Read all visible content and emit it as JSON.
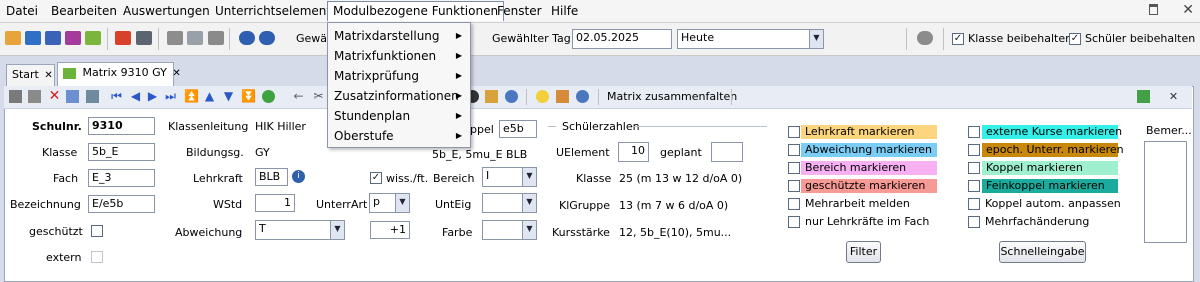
{
  "menubar": {
    "items": [
      "Datei",
      "Bearbeiten",
      "Auswertungen",
      "Unterrichtselement",
      "Modulbezogene Funktionen",
      "Fenster",
      "Hilfe"
    ]
  },
  "toolbar": {
    "gewaehlt_truncated": "Gewä",
    "gewaehlter_tag_label": "Gewählter Tag",
    "date_value": "02.05.2025",
    "heute_value": "Heute",
    "klasse_beibehalten": "Klasse beibehalten",
    "schueler_beibehalten": "Schüler beibehalten"
  },
  "tabs": [
    {
      "label": "Start"
    },
    {
      "label": "Matrix 9310 GY"
    }
  ],
  "dropdown": {
    "items": [
      "Matrixdarstellung",
      "Matrixfunktionen",
      "Matrixprüfung",
      "Zusatzinformationen",
      "Stundenplan",
      "Oberstufe"
    ]
  },
  "innerbar": {
    "matrix_zusammenfalten": "Matrix zusammenfalten"
  },
  "form": {
    "schulnr_label": "Schulnr.",
    "schulnr_value": "9310",
    "klassenleitung_label": "Klassenleitung",
    "klassenleitung_value": "HIK Hiller",
    "koppel_label": "ppel",
    "koppel_value": "e5b",
    "klasse_label": "Klasse",
    "klasse_value": "5b_E",
    "bildungsg_label": "Bildungsg.",
    "bildungsg_value": "GY",
    "koppel_klassen_value": "5b_E, 5mu_E BLB",
    "fach_label": "Fach",
    "fach_value": "E_3",
    "lehrkraft_label": "Lehrkraft",
    "lehrkraft_value": "BLB",
    "wissft_label": "wiss./ft.",
    "bereich_label": "Bereich",
    "bereich_value": "I",
    "bezeichnung_label": "Bezeichnung",
    "bezeichnung_value": "E/e5b",
    "wstd_label": "WStd",
    "wstd_value": "1",
    "unterrart_label": "UnterrArt",
    "unterrart_value": "p",
    "unteig_label": "UntEig",
    "geschuetzt_label": "geschützt",
    "abweichung_label": "Abweichung",
    "abweichung_value": "T",
    "abweichung_num": "+1",
    "farbe_label": "Farbe",
    "extern_label": "extern"
  },
  "schuelerzahlen": {
    "title": "Schülerzahlen",
    "uelement_label": "UElement",
    "uelement_value": "10",
    "geplant_label": "geplant",
    "klasse_label": "Klasse",
    "klasse_value": "25 (m 13 w 12 d/oA 0)",
    "klgruppe_label": "KlGruppe",
    "klgruppe_value": "13 (m 7 w 6 d/oA 0)",
    "kursstaerke_label": "Kursstärke",
    "kursstaerke_value": "12, 5b_E(10), 5mu..."
  },
  "markers": {
    "lehrkraft": {
      "label": "Lehrkraft markieren",
      "color": "#fcd57e"
    },
    "abweichung": {
      "label": "Abweichung markieren",
      "color": "#7ccdf6"
    },
    "bereich": {
      "label": "Bereich markieren",
      "color": "#f7b0f2"
    },
    "geschuetzte": {
      "label": "geschützte markieren",
      "color": "#f79a95"
    },
    "mehrarbeit": {
      "label": "Mehrarbeit melden"
    },
    "nur_lehrkraefte": {
      "label": "nur Lehrkräfte im Fach"
    },
    "externe": {
      "label": "externe Kurse markieren",
      "color": "#34f0e8"
    },
    "epoch": {
      "label": "epoch. Unterr. markieren",
      "color": "#c8880c"
    },
    "koppel": {
      "label": "Koppel markieren",
      "color": "#9ff0cf"
    },
    "feinkoppel": {
      "label": "Feinkoppel markieren",
      "color": "#1aab9d"
    },
    "koppel_autom": {
      "label": "Koppel autom. anpassen"
    },
    "mehrfach": {
      "label": "Mehrfachänderung"
    }
  },
  "buttons": {
    "filter": "Filter",
    "schnelleingabe": "Schnelleingabe"
  },
  "bemerkung": {
    "label": "Bemer..."
  }
}
